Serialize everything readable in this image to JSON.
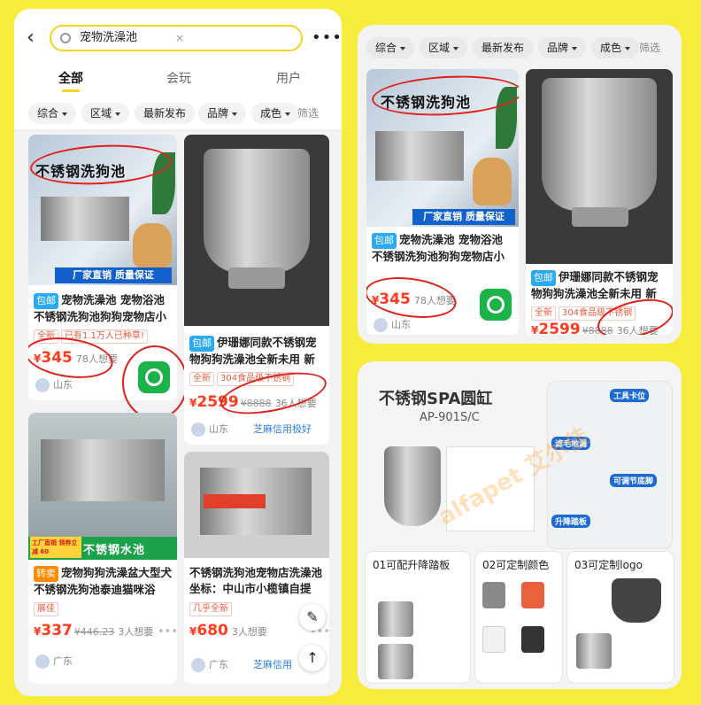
{
  "search": {
    "query": "宠物洗澡池",
    "clear": "×",
    "back": "‹",
    "more": "•••"
  },
  "tabs": [
    "全部",
    "会玩",
    "用户"
  ],
  "filters": [
    "综合",
    "区域",
    "最新发布",
    "品牌",
    "成色"
  ],
  "filter_more": "筛选",
  "cards": [
    {
      "overlay": "不锈钢洗狗池",
      "banner": "厂家直销 质量保证",
      "badge": "包邮",
      "title": "宠物洗澡池 宠物浴池 不锈钢洗狗池狗狗宠物店小",
      "tags": [
        "全新",
        "已有1.1万人已种草!"
      ],
      "price_symbol": "¥",
      "price": "345",
      "want": "78人想要",
      "loc": "山东"
    },
    {
      "badge": "包邮",
      "title": "伊珊娜同款不锈钢宠物狗狗洗澡池全新未用 新款",
      "tags": [
        "全新",
        "304食品级不锈钢"
      ],
      "price_symbol": "¥",
      "price": "2599",
      "old": "¥8888",
      "want": "36人想要",
      "loc": "山东",
      "credit": "芝麻信用极好"
    },
    {
      "overlay": "不锈钢水池",
      "promo": "工厂直销 领券立减 60",
      "badge": "转卖",
      "title": "宠物狗狗洗澡盆大型犬不锈钢洗狗池泰迪猫咪浴",
      "tags": [
        "展佳"
      ],
      "price_symbol": "¥",
      "price": "337",
      "old": "¥446.23",
      "want": "3人想要",
      "loc": "广东"
    },
    {
      "title": "不锈钢洗狗池宠物店洗澡池 坐标：中山市小榄镇自提",
      "tags": [
        "几乎全新"
      ],
      "price_symbol": "¥",
      "price": "680",
      "want": "3人想要",
      "loc": "广东",
      "credit": "芝麻信用"
    }
  ],
  "panel2": {
    "filters": [
      "综合",
      "区域",
      "最新发布",
      "品牌",
      "成色"
    ],
    "filter_more": "筛选",
    "left": {
      "overlay": "不锈钢洗狗池",
      "banner": "厂家直销 质量保证",
      "badge": "包邮",
      "title": "宠物洗澡池 宠物浴池 不锈钢洗狗池狗狗宠物店小",
      "price_symbol": "¥",
      "price": "345",
      "want": "78人想要",
      "loc": "山东"
    },
    "right": {
      "badge": "包邮",
      "title": "伊珊娜同款不锈钢宠物狗狗洗澡池全新未用 新款",
      "tags": [
        "全新",
        "304食品级不锈钢"
      ],
      "price_symbol": "¥",
      "price": "2599",
      "old": "¥8888",
      "want": "36人想要"
    }
  },
  "panel3": {
    "title": "不锈钢SPA圆缸",
    "model": "AP-901S/C",
    "f1": "工具卡位",
    "f2": "滤毛地漏",
    "f3": "可调节底脚",
    "f4": "升降踏板",
    "s1": "01可配升降踏板",
    "s2": "02可定制颜色",
    "s3": "03可定制logo",
    "brand": "alfapet 艾尔佳"
  },
  "colors": {
    "accent": "#f7d21e",
    "price": "#ff3b1f",
    "bg": "#f7ec3c",
    "circle": "#e0201a"
  }
}
